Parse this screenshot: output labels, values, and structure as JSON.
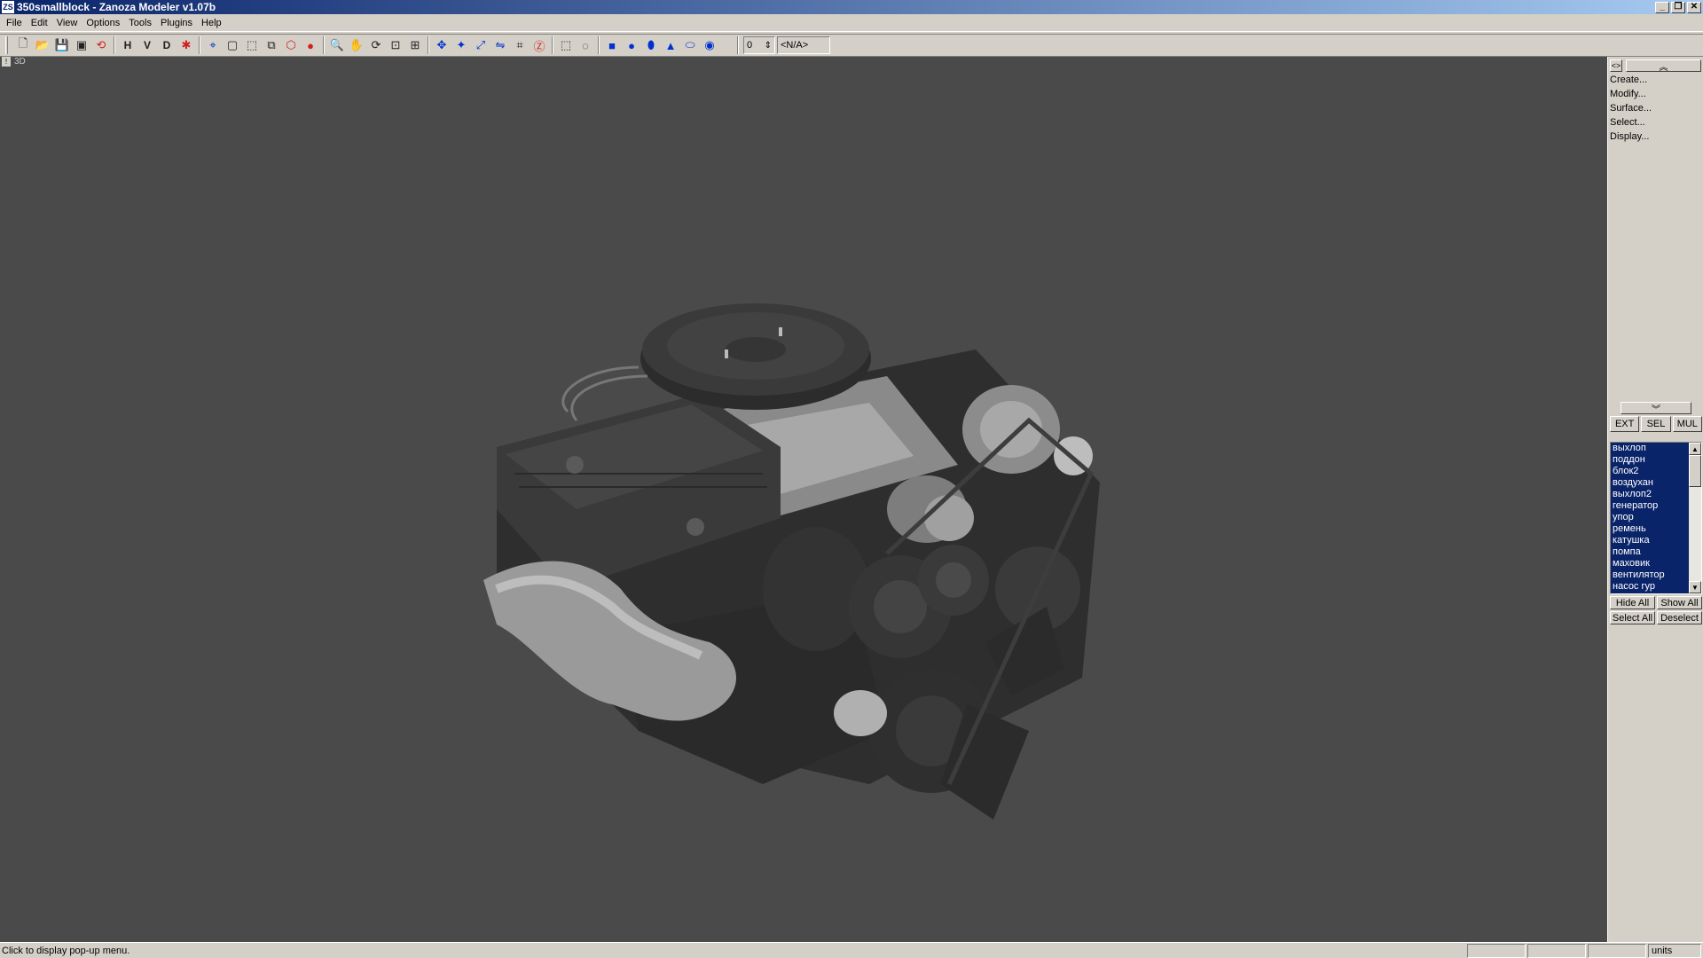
{
  "window": {
    "icon_text": "ZS",
    "title": "350smallblock - Zanoza Modeler v1.07b",
    "minimize_glyph": "_",
    "maximize_glyph": "❐",
    "close_glyph": "✕"
  },
  "menu": [
    "File",
    "Edit",
    "View",
    "Options",
    "Tools",
    "Plugins",
    "Help"
  ],
  "toolbar": {
    "h_label": "H",
    "v_label": "V",
    "d_label": "D",
    "spin_value": "0",
    "spin_arrows": "⇕",
    "na_value": "<N/A>"
  },
  "viewport": {
    "pin_glyph": "!",
    "label": "3D",
    "background": "#4a4a4a"
  },
  "panel": {
    "toggle_glyph": "<>",
    "scroll_up_glyph": "︽",
    "scroll_down_glyph": "︾",
    "commands": [
      "Create...",
      "Modify...",
      "Surface...",
      "Select...",
      "Display..."
    ],
    "modes": [
      "EXT",
      "SEL",
      "MUL"
    ],
    "objects": [
      "выхлоп",
      "поддон",
      "блок2",
      "воздухан",
      "выхлоп2",
      "генератор",
      "упор",
      "ремень",
      "катушка",
      "помпа",
      "маховик",
      "вентилятор",
      "насос гур"
    ],
    "scroll_up_arrow": "▲",
    "scroll_down_arrow": "▼",
    "actions": [
      "Hide All",
      "Show All",
      "Select All",
      "Deselect"
    ]
  },
  "status": {
    "message": "Click to display pop-up menu.",
    "units": "units"
  },
  "colors": {
    "selection": "#0a246a",
    "titlebar_start": "#0a246a",
    "titlebar_end": "#a6caf0"
  }
}
